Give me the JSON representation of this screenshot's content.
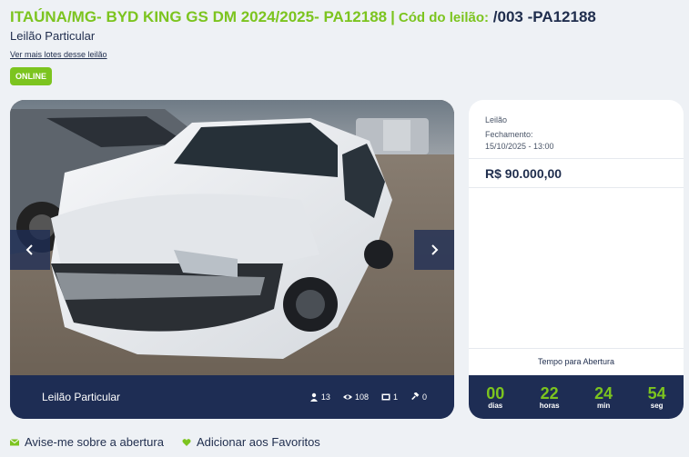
{
  "header": {
    "title": "ITAÚNA/MG- BYD KING GS DM 2024/2025- PA12188",
    "separator": "|",
    "code_label": "Cód do leilão:",
    "code_value": "/003 -PA12188",
    "subtitle": "Leilão Particular",
    "more_lots_link": "Ver mais lotes desse leilão",
    "status_badge": "ONLINE"
  },
  "gallery": {
    "photo_icon": "car-photo",
    "prev_icon": "chevron-left-icon",
    "next_icon": "chevron-right-icon",
    "bar_title": "Leilão Particular",
    "stats": [
      {
        "icon": "user-icon",
        "value": "13"
      },
      {
        "icon": "eye-icon",
        "value": "108"
      },
      {
        "icon": "image-icon",
        "value": "1"
      },
      {
        "icon": "gavel-icon",
        "value": "0"
      }
    ]
  },
  "panel": {
    "label": "Leilão",
    "closing_label": "Fechamento:",
    "closing_value": "15/10/2025 - 13:00",
    "price": "R$ 90.000,00",
    "timer_label": "Tempo para Abertura",
    "countdown": [
      {
        "value": "00",
        "unit": "dias"
      },
      {
        "value": "22",
        "unit": "horas"
      },
      {
        "value": "24",
        "unit": "min"
      },
      {
        "value": "54",
        "unit": "seg"
      }
    ]
  },
  "actions": [
    {
      "icon": "envelope-icon",
      "label": "Avise-me sobre a abertura"
    },
    {
      "icon": "heart-icon",
      "label": "Adicionar aos Favoritos"
    }
  ],
  "colors": {
    "accent": "#7cc41f",
    "navy": "#1e2d54",
    "background": "#eef1f5"
  }
}
